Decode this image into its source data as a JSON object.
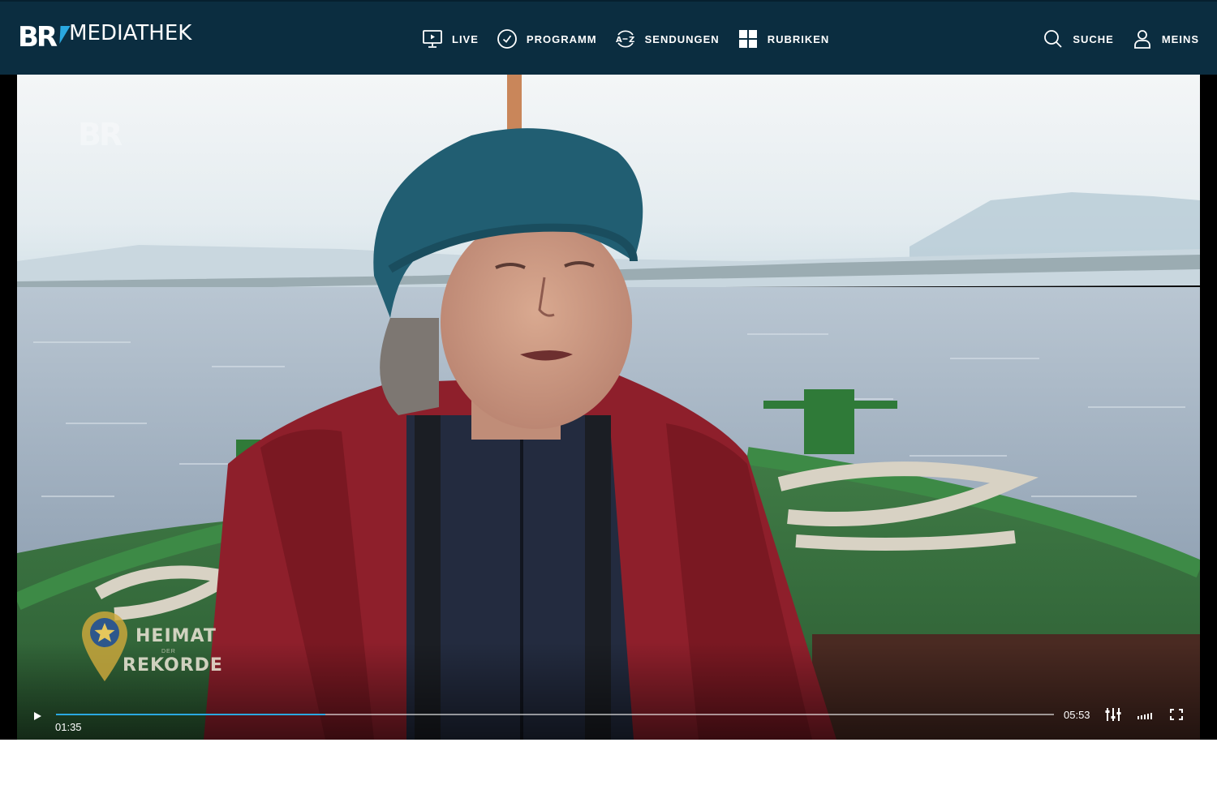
{
  "header": {
    "logo": {
      "br": "BR",
      "text": "MEDIATHEK"
    },
    "nav": [
      {
        "label": "LIVE",
        "icon": "monitor-play-icon"
      },
      {
        "label": "PROGRAMM",
        "icon": "clock-icon"
      },
      {
        "label": "SENDUNGEN",
        "icon": "a-z-icon"
      },
      {
        "label": "RUBRIKEN",
        "icon": "grid-icon"
      }
    ],
    "right": [
      {
        "label": "SUCHE",
        "icon": "search-icon"
      },
      {
        "label": "MEINS",
        "icon": "user-icon"
      }
    ]
  },
  "player": {
    "watermark": "BR",
    "badge": {
      "line1": "HEIMAT",
      "small": "DER",
      "line2": "REKORDE"
    },
    "time_current": "01:35",
    "time_total": "05:53",
    "progress_fraction": 0.27,
    "colors": {
      "accent": "#2aa8e0",
      "header_bg": "#0b2d40"
    }
  }
}
